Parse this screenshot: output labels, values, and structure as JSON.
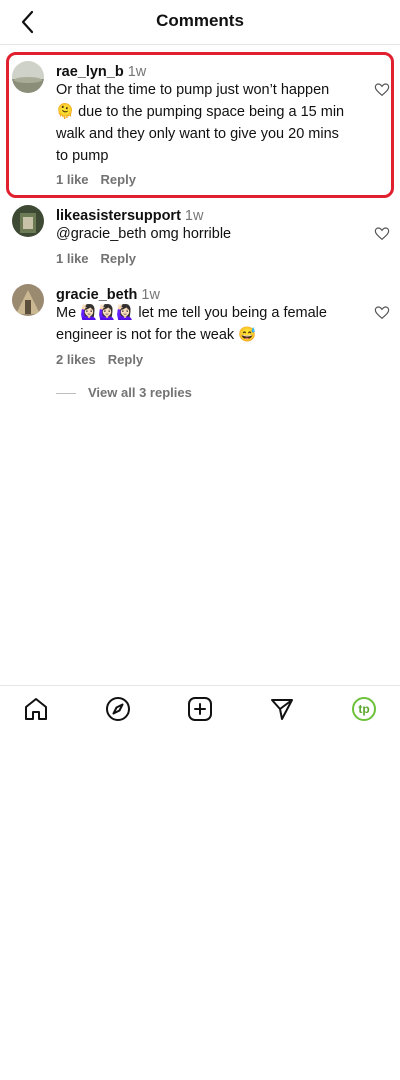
{
  "header": {
    "title": "Comments"
  },
  "comments": [
    {
      "username": "rae_lyn_b",
      "time": "1w",
      "text": "Or that the time to pump just won’t happen 🫠 due to the pumping space being a 15 min walk and they only want to give you 20 mins to pump",
      "likes": "1 like",
      "reply": "Reply"
    },
    {
      "username": "likeasistersupport",
      "time": "1w",
      "text": "@gracie_beth omg horrible",
      "likes": "1 like",
      "reply": "Reply"
    },
    {
      "username": "gracie_beth",
      "time": "1w",
      "text": "Me 🙋🏻‍♀️🙋🏻‍♀️🙋🏻‍♀️ let me tell you being a female engineer is not for the weak 😅",
      "likes": "2 likes",
      "reply": "Reply"
    }
  ],
  "view_replies": "View all 3 replies",
  "bottom_nav": {
    "items": [
      "home-icon",
      "explore-icon",
      "add-icon",
      "send-icon",
      "profile-avatar"
    ],
    "profile_initials": "tp",
    "accent": "#6cc13a"
  },
  "highlight_color": "#e0202e"
}
